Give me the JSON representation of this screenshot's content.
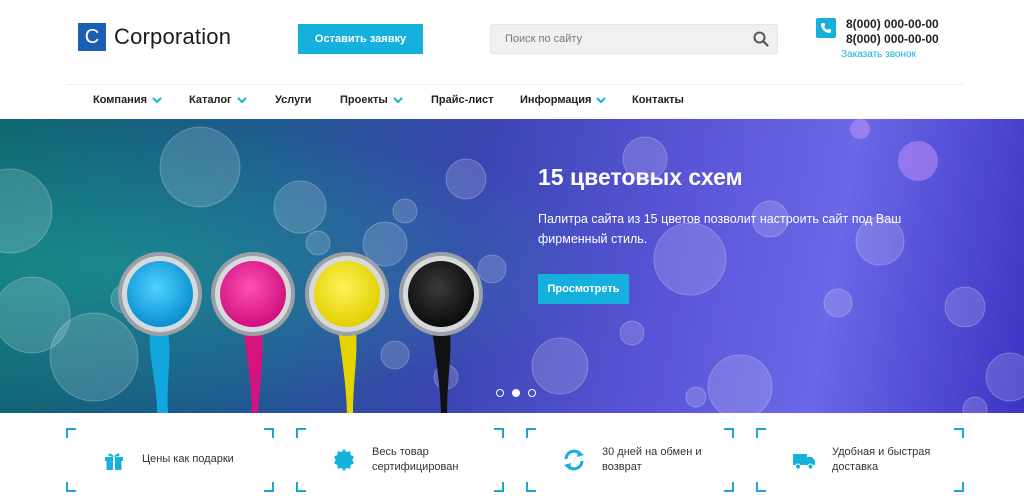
{
  "header": {
    "logo_letter": "C",
    "logo_text": "Corporation",
    "cta_label": "Оставить заявку",
    "search_placeholder": "Поиск по сайту",
    "phone1": "8(000) 000-00-00",
    "phone2": "8(000) 000-00-00",
    "callback_label": "Заказать звонок"
  },
  "nav": {
    "items": [
      {
        "label": "Компания"
      },
      {
        "label": "Каталог"
      },
      {
        "label": "Услуги"
      },
      {
        "label": "Проекты"
      },
      {
        "label": "Прайс-лист"
      },
      {
        "label": "Информация"
      },
      {
        "label": "Контакты"
      }
    ]
  },
  "hero": {
    "title": "15 цветовых схем",
    "text": "Палитра сайта из 15 цветов позволит настроить сайт под Ваш фирменный стиль.",
    "button_label": "Просмотреть",
    "slide_count": 3,
    "active_slide": 2
  },
  "features": [
    {
      "text": "Цены как подарки",
      "icon": "gift-icon"
    },
    {
      "text": "Весь товар сертифицирован",
      "icon": "certificate-icon"
    },
    {
      "text": "30 дней на обмен и возврат",
      "icon": "refresh-icon"
    },
    {
      "text": "Удобная и быстрая доставка",
      "icon": "truck-icon"
    }
  ],
  "colors": {
    "accent": "#16b0dc",
    "logo_blue": "#1a5fb4"
  }
}
